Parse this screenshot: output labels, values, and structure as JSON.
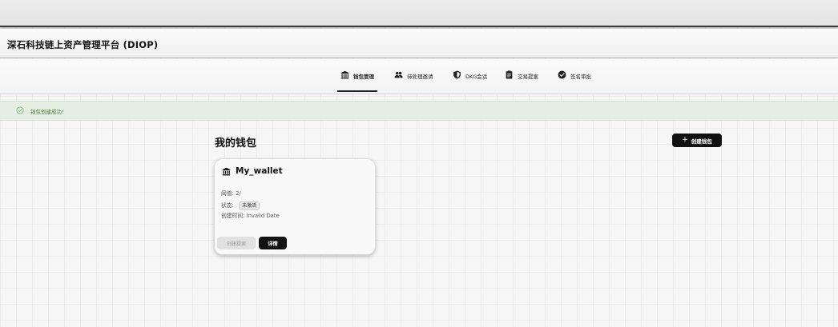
{
  "app": {
    "title": "深石科技链上资产管理平台 (DIOP)"
  },
  "nav": {
    "tabs": [
      {
        "label": "钱包管理",
        "icon": "bank-icon",
        "active": true
      },
      {
        "label": "待处理邀请",
        "icon": "people-icon",
        "active": false
      },
      {
        "label": "DKG会话",
        "icon": "shield-icon",
        "active": false
      },
      {
        "label": "交易提案",
        "icon": "clipboard-icon",
        "active": false
      },
      {
        "label": "签名审批",
        "icon": "check-circle-icon",
        "active": false
      }
    ]
  },
  "alert": {
    "message": "钱包创建成功!",
    "icon": "check-circle-outline-icon",
    "color": "#4b7a44"
  },
  "main": {
    "title": "我的钱包",
    "create_button": "创建钱包",
    "create_button_icon": "plus-icon"
  },
  "wallet_card": {
    "name": "My_wallet",
    "icon": "bank-icon",
    "threshold_label": "阈值:",
    "threshold_value": "2/",
    "status_label": "状态:",
    "status_value": "未激活",
    "created_label": "创建时间:",
    "created_value": "Invalid Date",
    "proposal_button": "创建提案",
    "details_button": "详情"
  },
  "colors": {
    "accent": "#111111",
    "success_bg": "#e4efe1",
    "page_bg": "#f6f6f6"
  }
}
